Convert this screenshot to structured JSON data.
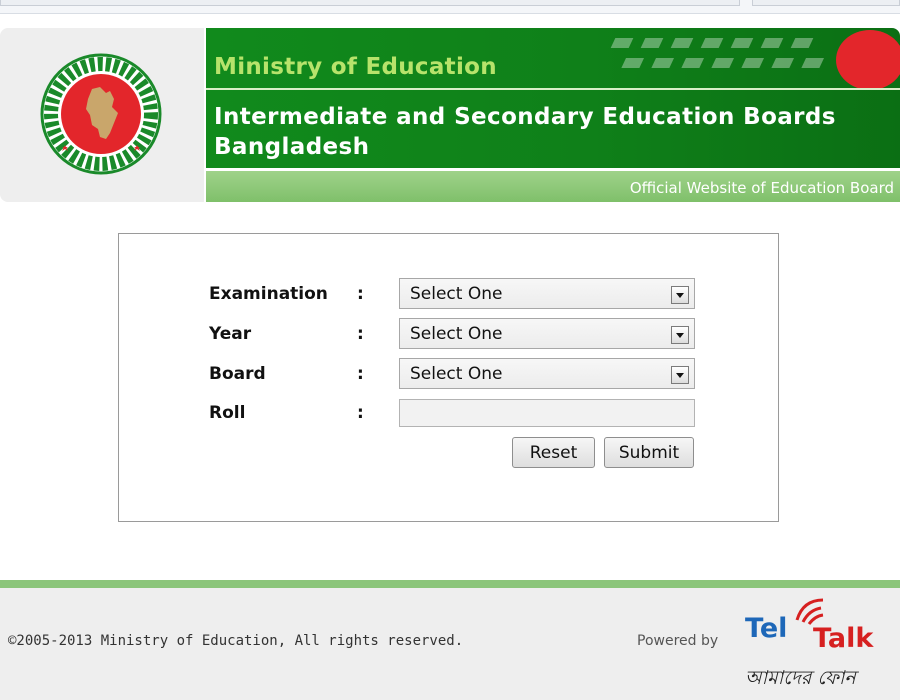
{
  "header": {
    "ministry": "Ministry of Education",
    "board_title_line1": "Intermediate and Secondary Education Boards",
    "board_title_line2": "Bangladesh",
    "official_site": "Official Website of Education Board",
    "logo_icon": "government-seal-icon",
    "colors": {
      "banner_green": "#118a1c",
      "ministry_text": "#b7e36b",
      "sub_banner": "#8bc57a"
    }
  },
  "form": {
    "fields": [
      {
        "label": "Examination",
        "colon": ":",
        "selected": "Select One"
      },
      {
        "label": "Year",
        "colon": ":",
        "selected": "Select One"
      },
      {
        "label": "Board",
        "colon": ":",
        "selected": "Select One"
      }
    ],
    "roll": {
      "label": "Roll",
      "colon": ":",
      "value": ""
    },
    "reset_label": "Reset",
    "submit_label": "Submit"
  },
  "footer": {
    "copyright": "©2005-2013 Ministry of Education, All rights reserved.",
    "powered_by": "Powered by",
    "brand_tel": "Tel",
    "brand_talk": "Talk",
    "brand_tagline": "আমাদের ফোন"
  }
}
